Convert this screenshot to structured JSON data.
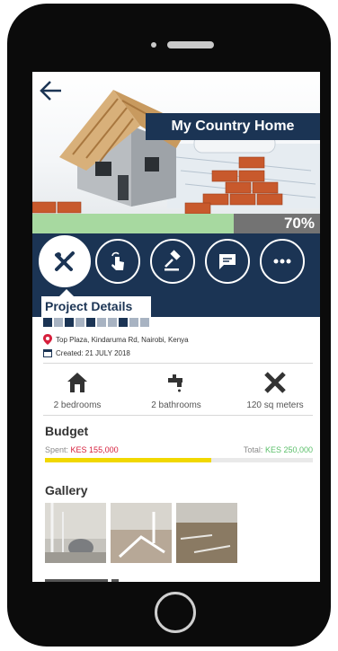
{
  "project": {
    "name": "My Country Home",
    "progress_percent": 70,
    "progress_label": "70%"
  },
  "actions": [
    {
      "name": "tools",
      "icon": "tools-icon",
      "active": true
    },
    {
      "name": "tap",
      "icon": "hand-tap-icon",
      "active": false
    },
    {
      "name": "gavel",
      "icon": "gavel-icon",
      "active": false
    },
    {
      "name": "chat",
      "icon": "chat-icon",
      "active": false
    },
    {
      "name": "more",
      "icon": "more-icon",
      "active": false
    }
  ],
  "tab": {
    "label": "Project Details"
  },
  "details": {
    "location": "Top Plaza, Kindaruma Rd, Nairobi, Kenya",
    "created": "Created: 21 JULY 2018"
  },
  "features": [
    {
      "label": "2 bedrooms",
      "icon": "house-icon"
    },
    {
      "label": "2 bathrooms",
      "icon": "faucet-icon"
    },
    {
      "label": "120 sq meters",
      "icon": "ruler-pencil-icon"
    }
  ],
  "budget": {
    "title": "Budget",
    "spent_label": "Spent:",
    "spent_value": "KES 155,000",
    "total_label": "Total:",
    "total_value": "KES 250,000",
    "spent_fraction": 0.62
  },
  "gallery": {
    "title": "Gallery"
  },
  "colors": {
    "primary": "#1b3454",
    "spent": "#d61f3c",
    "total": "#5bbf6a",
    "budget_bar": "#f1d800",
    "progress": "#a7d9a0"
  }
}
